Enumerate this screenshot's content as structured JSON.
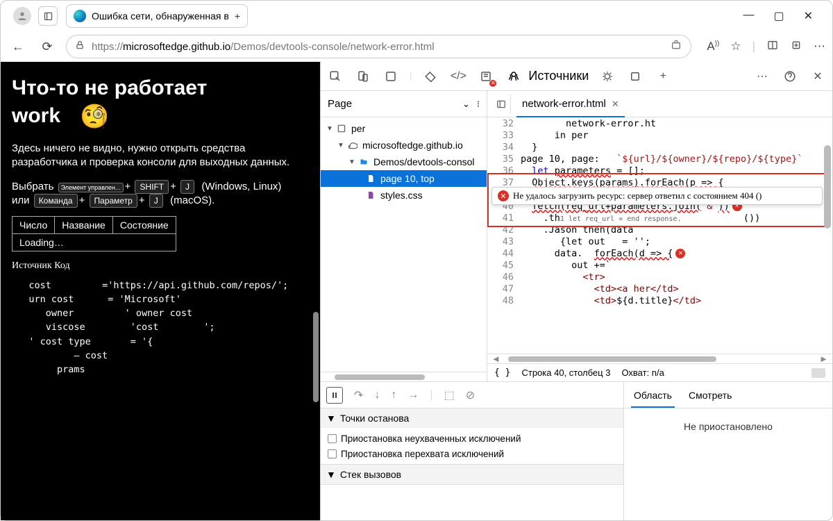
{
  "window": {
    "tab_title": "Ошибка сети, обнаруженная в",
    "tab_plus": "+"
  },
  "address": {
    "host": "microsoftedge.github.io",
    "path": "/Demos/devtools-console/network-error.html",
    "scheme": "https://"
  },
  "page": {
    "h1_a": "Что-то не работает",
    "h1_b": "work",
    "emoji": "🧐",
    "desc": "Здесь ничего не видно, нужно открыть средства разработчика и проверка консоли для выходных данных.",
    "keys": {
      "pick": "Выбрать",
      "k1": "Элемент управлен...",
      "k2": "SHIFT",
      "k3": "J",
      "win": "(Windows, Linux)",
      "or": "или",
      "k4": "Команда",
      "k5": "Параметр",
      "k6": "J",
      "mac": "(macOS)."
    },
    "table": {
      "c1": "Число",
      "c2": "Название",
      "c3": "Состояние",
      "loading": "Loading…"
    },
    "src": {
      "hdr": "Источник Код",
      "l1a": "cost",
      "l1b": "='https://api.github.com/repos/';",
      "l2a": "urn cost",
      "l2b": "= 'Microsoft'",
      "l3a": "owner",
      "l3b": "' owner cost",
      "l4a": "viscose",
      "l4b": "'cost        ';",
      "l5a": "' cost type",
      "l5b": "= '{",
      "l6": "– cost",
      "l7": "prams"
    }
  },
  "devtools": {
    "title": "Источники",
    "left": {
      "label": "Page",
      "tree": {
        "root": "per",
        "host": "microsoftedge.github.io",
        "folder": "Demos/devtools-consol",
        "file1": "page 10, top",
        "file2": "styles.css"
      }
    },
    "tabs": {
      "file": "network-error.html"
    },
    "tooltip": "Не удалось загрузить ресурс: сервер ответил с состоянием 404 ()",
    "code": {
      "32": "network-error.ht",
      "33": "in per",
      "34": "}",
      "35p": "page 10, page:",
      "35c": "`${url}/${owner}/${repo}/${type}`",
      "36": "let parameters = [];",
      "37": "Object.keys(params).forEach(p => {",
      "39": "};",
      "40a": "fetch(req_url+parameters.join(",
      "40b": "'&'",
      "40c": "))",
      "41a": ".th",
      "41b": "1 let req_url = end response.",
      "41c": "())",
      "42": ".Jason then(data",
      "43": "{let out   = '';",
      "44a": "data.  ",
      "44b": "forEach(d => {",
      "45": "out +=`",
      "46": "<tr>",
      "47a": "<td>",
      "47b": "<a her",
      "47c": "</td>",
      "48a": "<td>",
      "48b": "${d.title}",
      "48c": "</td>"
    },
    "status": {
      "pos": "Строка 40, столбец 3",
      "cov": "Охват: n/a"
    },
    "breakpoints": {
      "hdr": "Точки останова",
      "opt1": "Приостановка неухваченных исключений",
      "opt2": "Приостановка перехвата исключений"
    },
    "callstack": {
      "hdr": "Стек вызовов"
    },
    "scope": {
      "t1": "Область",
      "t2": "Смотреть",
      "msg": "Не приостановлено"
    }
  }
}
